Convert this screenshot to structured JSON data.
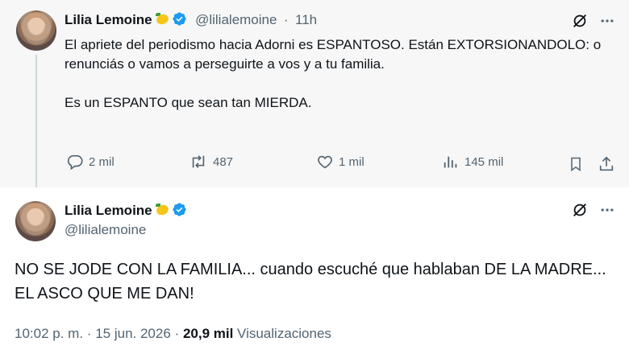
{
  "tweet1": {
    "author_name": "Lilia Lemoine",
    "handle": "@lilialemoine",
    "separator": "·",
    "time": "11h",
    "text_p1": "El apriete del periodismo hacia Adorni es ESPANTOSO. Están EXTORSIONANDOLO: o renunciás o vamos a perseguirte a vos y a tu familia.",
    "text_p2": "Es un ESPANTO que sean tan MIERDA.",
    "replies": "2 mil",
    "reposts": "487",
    "likes": "1 mil",
    "views": "145 mil"
  },
  "tweet2": {
    "author_name": "Lilia Lemoine",
    "handle": "@lilialemoine",
    "text": "NO SE JODE CON LA FAMILIA... cuando escuché que hablaban DE LA MADRE... EL ASCO QUE ME DAN!",
    "time": "10:02 p. m.",
    "dot": "·",
    "date": "15 jun. 2026",
    "dot2": "·",
    "views_count": "20,9 mil",
    "views_label": "Visualizaciones"
  },
  "colors": {
    "verified": "#1d9bf0",
    "secondary_text": "#536471",
    "primary_text": "#0f1419"
  },
  "icons": [
    "grok-icon",
    "more-icon",
    "reply-icon",
    "repost-icon",
    "like-icon",
    "views-icon",
    "bookmark-icon",
    "share-icon",
    "verified-badge-icon",
    "lemon-emoji-icon"
  ]
}
